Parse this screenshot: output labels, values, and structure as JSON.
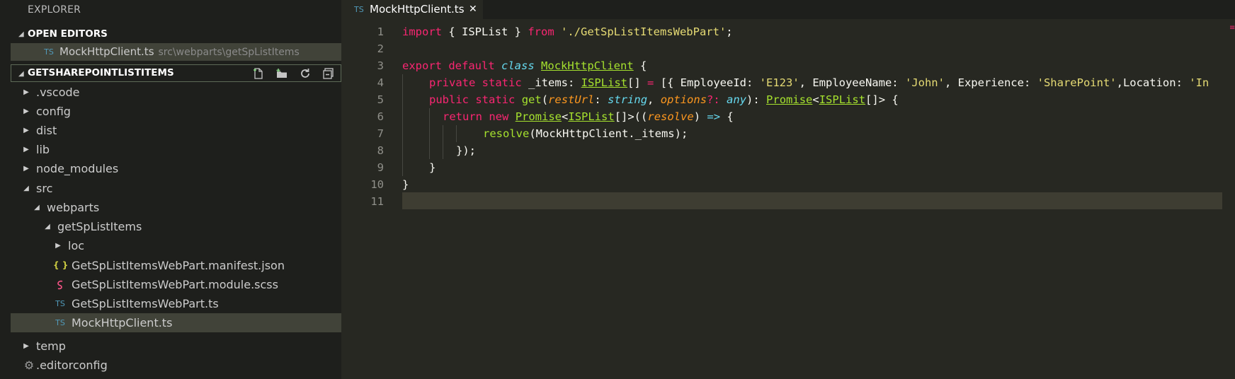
{
  "sidebar": {
    "title": "EXPLORER",
    "open_editors": {
      "label": "OPEN EDITORS",
      "items": [
        {
          "icon": "TS",
          "name": "MockHttpClient.ts",
          "path": "src\\webparts\\getSpListItems"
        }
      ]
    },
    "project": {
      "label": "GETSHAREPOINTLISTITEMS",
      "actions": [
        "new-file-icon",
        "new-folder-icon",
        "refresh-icon",
        "collapse-all-icon"
      ]
    },
    "tree": [
      {
        "name": ".vscode",
        "type": "folder",
        "expanded": false,
        "depth": 0
      },
      {
        "name": "config",
        "type": "folder",
        "expanded": false,
        "depth": 0
      },
      {
        "name": "dist",
        "type": "folder",
        "expanded": false,
        "depth": 0
      },
      {
        "name": "lib",
        "type": "folder",
        "expanded": false,
        "depth": 0
      },
      {
        "name": "node_modules",
        "type": "folder",
        "expanded": false,
        "depth": 0
      },
      {
        "name": "src",
        "type": "folder",
        "expanded": true,
        "depth": 0
      },
      {
        "name": "webparts",
        "type": "folder",
        "expanded": true,
        "depth": 1
      },
      {
        "name": "getSpListItems",
        "type": "folder",
        "expanded": true,
        "depth": 2
      },
      {
        "name": "loc",
        "type": "folder",
        "expanded": false,
        "depth": 3
      },
      {
        "name": "GetSpListItemsWebPart.manifest.json",
        "type": "json",
        "icon": "{ }",
        "depth": 3
      },
      {
        "name": "GetSpListItemsWebPart.module.scss",
        "type": "scss",
        "depth": 3
      },
      {
        "name": "GetSpListItemsWebPart.ts",
        "type": "ts",
        "icon": "TS",
        "depth": 3
      },
      {
        "name": "MockHttpClient.ts",
        "type": "ts",
        "icon": "TS",
        "depth": 3,
        "selected": true
      },
      {
        "name": "temp",
        "type": "folder",
        "expanded": false,
        "depth": 0
      },
      {
        "name": ".editorconfig",
        "type": "config",
        "depth": 0
      }
    ]
  },
  "editor": {
    "tab": {
      "icon": "TS",
      "label": "MockHttpClient.ts",
      "close": "✕"
    },
    "line_numbers": [
      "1",
      "2",
      "3",
      "4",
      "5",
      "6",
      "7",
      "8",
      "9",
      "10",
      "11"
    ],
    "code": {
      "l1": [
        "import",
        " { ISPList } ",
        "from",
        " ",
        "'./GetSpListItemsWebPart'",
        ";"
      ],
      "l3": [
        "export",
        " ",
        "default",
        " ",
        "class",
        " ",
        "MockHttpClient",
        " {"
      ],
      "l4": [
        "private",
        " ",
        "static",
        " _items: ",
        "ISPList",
        "[] ",
        "=",
        " [{ EmployeeId: ",
        "'E123'",
        ", EmployeeName: ",
        "'John'",
        ", Experience: ",
        "'SharePoint'",
        ",Location: ",
        "'In"
      ],
      "l5": [
        "public",
        " ",
        "static",
        " ",
        "get",
        "(",
        "restUrl",
        ": ",
        "string",
        ", ",
        "options",
        "?: ",
        "any",
        "): ",
        "Promise",
        "<",
        "ISPList",
        "[]> {"
      ],
      "l6": [
        "return",
        " ",
        "new",
        " ",
        "Promise",
        "<",
        "ISPList",
        "[]>((",
        "resolve",
        ") ",
        "=>",
        " {"
      ],
      "l7": [
        "resolve",
        "(MockHttpClient._items);"
      ],
      "l8": [
        "});"
      ],
      "l9": [
        "}"
      ],
      "l10": [
        "}"
      ]
    }
  },
  "colors": {
    "keyword": "#f92672",
    "string": "#e6db74",
    "type": "#66d9ef",
    "function": "#a6e22e",
    "param": "#fd971f",
    "background": "#272822",
    "sidebar": "#1e1f1c"
  }
}
